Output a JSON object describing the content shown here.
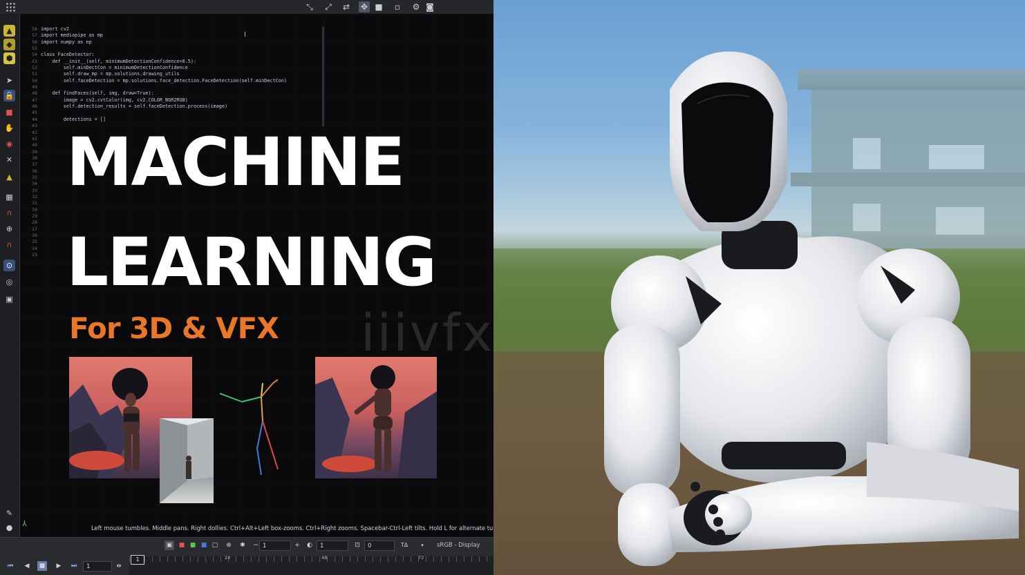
{
  "editor": {
    "code_lines": [
      {
        "no": "58",
        "code": "import cv2"
      },
      {
        "no": "57",
        "code": "import mediapipe as mp"
      },
      {
        "no": "56",
        "code": "import numpy as np"
      },
      {
        "no": "55",
        "code": ""
      },
      {
        "no": "54",
        "code": "class FaceDetector:"
      },
      {
        "no": "53",
        "code": "    def __init__(self, minimumDetectionConfidence=0.5):"
      },
      {
        "no": "52",
        "code": "        self.minDectCon = minimumDetectionConfidence"
      },
      {
        "no": "51",
        "code": "        self.draw_mp = mp.solutions.drawing_utils"
      },
      {
        "no": "50",
        "code": "        self.faceDetection = mp.solutions.face_detection.FaceDetection(self.minDectCon)"
      },
      {
        "no": "49",
        "code": ""
      },
      {
        "no": "48",
        "code": "    def findFaces(self, img, draw=True):"
      },
      {
        "no": "47",
        "code": "        image = cv2.cvtColor(img, cv2.COLOR_BGR2RGB)"
      },
      {
        "no": "46",
        "code": "        self.detection_results = self.faceDetection.process(image)"
      },
      {
        "no": "45",
        "code": ""
      },
      {
        "no": "44",
        "code": "        detections = []"
      }
    ],
    "extra_line_numbers": [
      "43",
      "42",
      "41",
      "40",
      "39",
      "38",
      "37",
      "36",
      "35",
      "34",
      "33",
      "32",
      "31",
      "30",
      "29",
      "28",
      "27",
      "26",
      "25",
      "24",
      "23"
    ]
  },
  "title": {
    "line1": "MACHINE",
    "line2": "LEARNING",
    "subtitle": "For 3D & VFX",
    "accent_color": "#e8772a"
  },
  "watermark": "iiivfx.com",
  "viewport": {
    "status_message": "Left mouse tumbles. Middle pans. Right dollies. Ctrl+Alt+Left box-zooms. Ctrl+Right zooms. Spacebar-Ctrl-Left tilts. Hold L for alternate tumb"
  },
  "bottombar": {
    "field1_value": "1",
    "field2_value": "1",
    "field3_value": "0",
    "display_label": "sRGB - Display",
    "frame_value": "1",
    "current_frame": "1",
    "timeline_ticks": [
      "24",
      "48",
      "72"
    ]
  }
}
